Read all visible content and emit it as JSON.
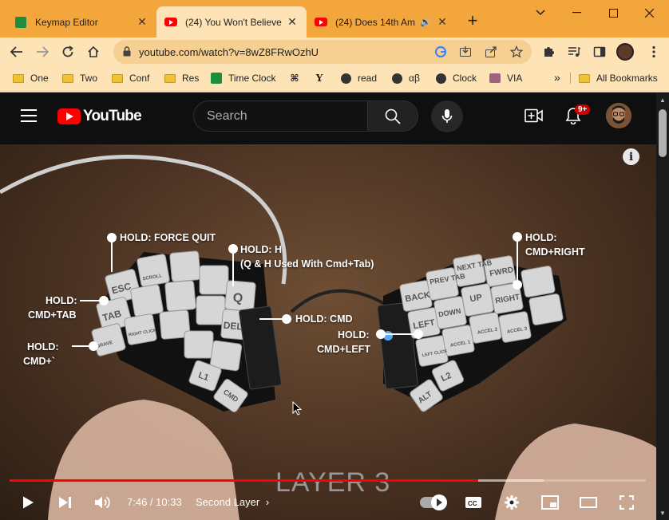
{
  "browser": {
    "tabs": [
      {
        "title": "Keymap Editor",
        "favicon": "green-sheet-icon",
        "active": false
      },
      {
        "title": "(24) You Won't Believe",
        "favicon": "youtube-icon",
        "active": true
      },
      {
        "title": "(24) Does 14th Am",
        "favicon": "youtube-icon",
        "active": false,
        "audio": true
      }
    ],
    "url": "youtube.com/watch?v=8wZ8FRwOzhU",
    "bookmarks": [
      {
        "label": "One",
        "icon": "folder-icon"
      },
      {
        "label": "Two",
        "icon": "folder-icon"
      },
      {
        "label": "Conf",
        "icon": "folder-icon"
      },
      {
        "label": "Res",
        "icon": "folder-icon"
      },
      {
        "label": "Time Clock",
        "icon": "timeclock-icon"
      },
      {
        "label": "",
        "icon": "command-icon"
      },
      {
        "label": "",
        "icon": "y-icon"
      },
      {
        "label": "read",
        "icon": "globe-icon"
      },
      {
        "label": "αβ",
        "icon": "globe-icon"
      },
      {
        "label": "Clock",
        "icon": "globe-icon"
      },
      {
        "label": "VIA",
        "icon": "via-icon"
      }
    ],
    "overflow": "»",
    "all_bookmarks": "All Bookmarks"
  },
  "youtube": {
    "brand": "YouTube",
    "search_placeholder": "Search",
    "notifications_badge": "9+"
  },
  "video": {
    "layer_title": "LAYER 3",
    "annotations": {
      "force_quit": "HOLD: FORCE QUIT",
      "hold_h": "HOLD: H",
      "hold_h_sub": "(Q & H Used With Cmd+Tab)",
      "cmd_tab_1": "HOLD:",
      "cmd_tab_2": "CMD+TAB",
      "cmd_grave_1": "HOLD:",
      "cmd_grave_2": "CMD+`",
      "hold_cmd": "HOLD: CMD",
      "cmd_left_1": "HOLD:",
      "cmd_left_2": "CMD+LEFT",
      "cmd_right_1": "HOLD:",
      "cmd_right_2": "CMD+RIGHT"
    },
    "keys": {
      "esc": "ESC",
      "tab": "TAB",
      "grave": "GRAVE",
      "scroll": "SCROLL",
      "right_click": "RIGHT CLICK",
      "q": "Q",
      "del": "DEL",
      "l1": "L1",
      "cmd": "CMD",
      "back": "BACK",
      "prev_tab": "PREV TAB",
      "next_tab": "NEXT TAB",
      "fwrd": "FWRD",
      "left": "LEFT",
      "down": "DOWN",
      "up": "UP",
      "right": "RIGHT",
      "accel1": "ACCEL 1",
      "accel2": "ACCEL 2",
      "accel3": "ACCEL 3",
      "left_click": "LEFT CLICK",
      "l2": "L2",
      "alt": "ALT"
    },
    "player": {
      "current_time": "7:46",
      "duration": "10:33",
      "time_display": "7:46 / 10:33",
      "chapter": "Second Layer",
      "chapter_chevron": "›",
      "progress_fraction": 0.737,
      "buffered_fraction": 0.84
    }
  },
  "colors": {
    "tabstrip": "#f3a63b",
    "toolbar": "#fde3b6",
    "youtube_red": "#ff0000",
    "yt_bg": "#0f0f0f"
  }
}
